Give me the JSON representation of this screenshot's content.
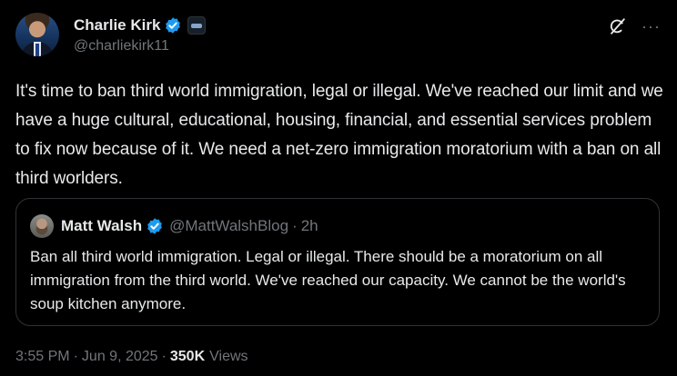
{
  "author": {
    "display_name": "Charlie Kirk",
    "handle": "@charliekirk11"
  },
  "tweet": {
    "text": "It's time to ban third world immigration, legal or illegal. We've reached our limit and we have a huge cultural, educational, housing, financial, and essential services problem to fix now because of it. We need a net-zero immigration moratorium with a ban on all third worlders."
  },
  "quoted_tweet": {
    "display_name": "Matt Walsh",
    "handle": "@MattWalshBlog",
    "separator": "·",
    "time": "2h",
    "text": "Ban all third world immigration. Legal or illegal. There should be a moratorium on all immigration from the third world. We've reached our capacity. We cannot be the world's soup kitchen anymore."
  },
  "meta": {
    "time": "3:55 PM",
    "separator": "·",
    "date": "Jun 9, 2025",
    "views_count": "350K",
    "views_label": "Views"
  },
  "header_icons": {
    "more_label": "···"
  },
  "colors": {
    "background": "#000000",
    "text": "#e7e9ea",
    "secondary": "#71767b",
    "verified": "#1d9bf0",
    "border": "#2f3336"
  },
  "icons": [
    "verified-badge-icon",
    "affiliate-badge-icon",
    "grok-icon",
    "more-icon"
  ]
}
